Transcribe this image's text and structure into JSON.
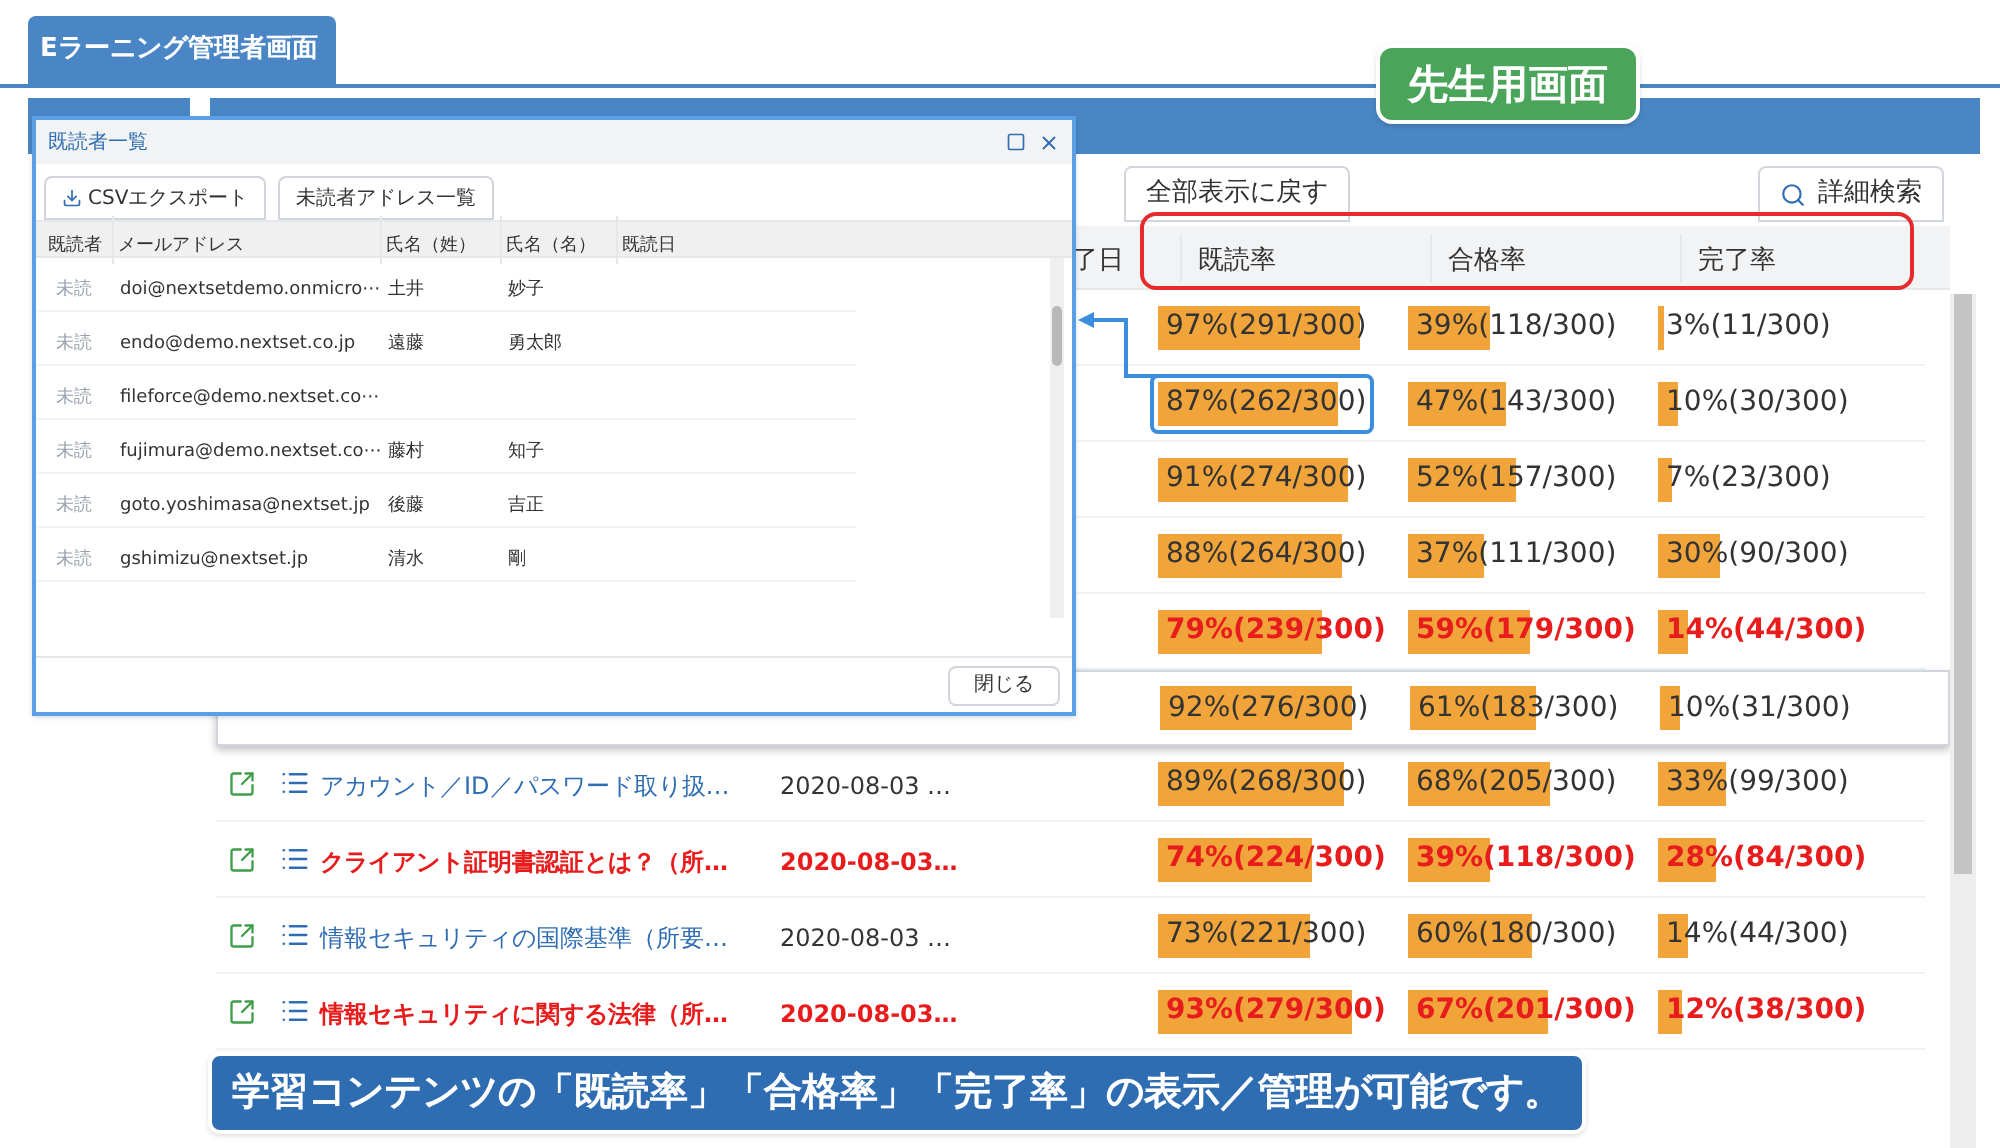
{
  "app": {
    "title": "Eラーニング管理者画面"
  },
  "badge": "先生用画面",
  "toolbar": {
    "buttons": [
      {
        "label": "全部表示に戻す",
        "kind": "plain"
      },
      {
        "label": "詳細検索",
        "kind": "search"
      }
    ]
  },
  "table": {
    "columns": [
      "了日",
      "既読率",
      "合格率",
      "完了率"
    ],
    "rows": [
      {
        "alert": false,
        "hovered": false,
        "rates": [
          {
            "text": "97%(291/300)",
            "level": 0.97,
            "outlined": false
          },
          {
            "text": "39%(118/300)",
            "level": 0.39,
            "outlined": false
          },
          {
            "text": "3%(11/300)",
            "level": 0.03,
            "outlined": false
          }
        ]
      },
      {
        "alert": false,
        "hovered": false,
        "rates": [
          {
            "text": "87%(262/300)",
            "level": 0.87,
            "outlined": true
          },
          {
            "text": "47%(143/300)",
            "level": 0.47,
            "outlined": false
          },
          {
            "text": "10%(30/300)",
            "level": 0.1,
            "outlined": false
          }
        ]
      },
      {
        "alert": false,
        "hovered": false,
        "rates": [
          {
            "text": "91%(274/300)",
            "level": 0.91,
            "outlined": false
          },
          {
            "text": "52%(157/300)",
            "level": 0.52,
            "outlined": false
          },
          {
            "text": "7%(23/300)",
            "level": 0.07,
            "outlined": false
          }
        ]
      },
      {
        "alert": false,
        "hovered": false,
        "rates": [
          {
            "text": "88%(264/300)",
            "level": 0.88,
            "outlined": false
          },
          {
            "text": "37%(111/300)",
            "level": 0.37,
            "outlined": false
          },
          {
            "text": "30%(90/300)",
            "level": 0.3,
            "outlined": false
          }
        ]
      },
      {
        "alert": true,
        "hovered": false,
        "rates": [
          {
            "text": "79%(239/300)",
            "level": 0.79,
            "outlined": false
          },
          {
            "text": "59%(179/300)",
            "level": 0.59,
            "outlined": false
          },
          {
            "text": "14%(44/300)",
            "level": 0.14,
            "outlined": false
          }
        ]
      },
      {
        "alert": false,
        "hovered": true,
        "rates": [
          {
            "text": "92%(276/300)",
            "level": 0.92,
            "outlined": false
          },
          {
            "text": "61%(183/300)",
            "level": 0.61,
            "outlined": false
          },
          {
            "text": "10%(31/300)",
            "level": 0.1,
            "outlined": false
          }
        ]
      },
      {
        "alert": false,
        "hovered": false,
        "title": "アカウント／ID／パスワード取り扱…",
        "date": "2020-08-03 …",
        "rates": [
          {
            "text": "89%(268/300)",
            "level": 0.89,
            "outlined": false
          },
          {
            "text": "68%(205/300)",
            "level": 0.68,
            "outlined": false
          },
          {
            "text": "33%(99/300)",
            "level": 0.33,
            "outlined": false
          }
        ]
      },
      {
        "alert": true,
        "hovered": false,
        "title": "クライアント証明書認証とは？（所…",
        "date": "2020-08-03…",
        "rates": [
          {
            "text": "74%(224/300)",
            "level": 0.74,
            "outlined": false
          },
          {
            "text": "39%(118/300)",
            "level": 0.39,
            "outlined": false
          },
          {
            "text": "28%(84/300)",
            "level": 0.28,
            "outlined": false
          }
        ]
      },
      {
        "alert": false,
        "hovered": false,
        "title": "情報セキュリティの国際基準（所要…",
        "date": "2020-08-03 …",
        "rates": [
          {
            "text": "73%(221/300)",
            "level": 0.73,
            "outlined": false
          },
          {
            "text": "60%(180/300)",
            "level": 0.6,
            "outlined": false
          },
          {
            "text": "14%(44/300)",
            "level": 0.14,
            "outlined": false
          }
        ]
      },
      {
        "alert": true,
        "hovered": false,
        "title": "情報セキュリティに関する法律（所…",
        "date": "2020-08-03…",
        "rates": [
          {
            "text": "93%(279/300)",
            "level": 0.93,
            "outlined": false
          },
          {
            "text": "67%(201/300)",
            "level": 0.67,
            "outlined": false
          },
          {
            "text": "12%(38/300)",
            "level": 0.12,
            "outlined": false
          }
        ]
      }
    ]
  },
  "dialog": {
    "title": "既読者一覧",
    "buttons": [
      {
        "label": "CSVエクスポート",
        "kind": "export"
      },
      {
        "label": "未読者アドレス一覧",
        "kind": "plain"
      }
    ],
    "columns": [
      "既読者",
      "メールアドレス",
      "氏名（姓）",
      "氏名（名）",
      "既読日"
    ],
    "rows": [
      {
        "status": "未読",
        "email": "doi@nextsetdemo.onmicro⋯",
        "last": "土井",
        "first": "妙子"
      },
      {
        "status": "未読",
        "email": "endo@demo.nextset.co.jp",
        "last": "遠藤",
        "first": "勇太郎"
      },
      {
        "status": "未読",
        "email": "fileforce@demo.nextset.co⋯"
      },
      {
        "status": "未読",
        "email": "fujimura@demo.nextset.co⋯",
        "last": "藤村",
        "first": "知子"
      },
      {
        "status": "未読",
        "email": "goto.yoshimasa@nextset.jp",
        "last": "後藤",
        "first": "吉正"
      },
      {
        "status": "未読",
        "email": "gshimizu@nextset.jp",
        "last": "清水",
        "first": "剛"
      }
    ],
    "close": "閉じる"
  },
  "banner": "学習コンテンツの「既読率」「合格率」「完了率」の表示／管理が可能です。"
}
